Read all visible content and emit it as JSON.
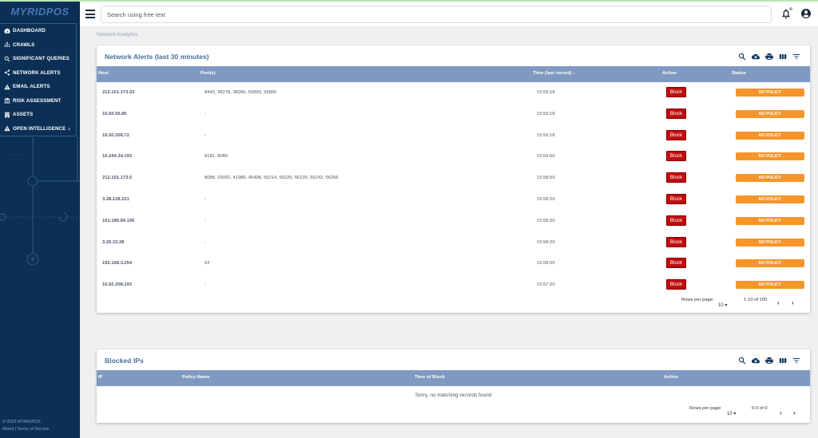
{
  "sidebar": {
    "brand": "MYRIDPOS",
    "items": [
      {
        "label": "DASHBOARD",
        "icon": "dashboard-icon"
      },
      {
        "label": "CRAWLS",
        "icon": "sitemap-icon"
      },
      {
        "label": "SIGNIFICANT QUERIES",
        "icon": "search-icon"
      },
      {
        "label": "NETWORK ALERTS",
        "icon": "share-icon"
      },
      {
        "label": "EMAIL ALERTS",
        "icon": "warning-icon"
      },
      {
        "label": "RISK ASSESSMENT",
        "icon": "bank-icon"
      },
      {
        "label": "ASSETS",
        "icon": "building-icon"
      },
      {
        "label": "OPEN INTELLIGENCE",
        "icon": "warning-icon"
      }
    ],
    "footer_copyright": "© 2023 MYRIDPOS",
    "footer_about": "About",
    "footer_sep": " | ",
    "footer_terms": "Terms of Service"
  },
  "topbar": {
    "search_placeholder": "Search using free text"
  },
  "breadcrumb": "Network Analytics",
  "alerts": {
    "title": "Network Alerts (last 30 minutes)",
    "columns": {
      "host": "Host",
      "ports": "Port(s)",
      "time": "Time (last record)",
      "sort_arrow": "↓",
      "action": "Action",
      "status": "Status"
    },
    "rows": [
      {
        "host": "212.101.173.33",
        "ports": "8443, 38278, 38286, 56890, 56896",
        "time": "15:59:18",
        "action": "Block",
        "status": "NO POLICY"
      },
      {
        "host": "16.50.56.80",
        "ports": "-",
        "time": "15:59:18",
        "action": "Block",
        "status": "NO POLICY"
      },
      {
        "host": "16.50.208.72",
        "ports": "-",
        "time": "15:59:18",
        "action": "Block",
        "status": "NO POLICY"
      },
      {
        "host": "10.244.34.193",
        "ports": "8181, 8080",
        "time": "15:59:00",
        "action": "Block",
        "status": "NO POLICY"
      },
      {
        "host": "212.101.173.5",
        "ports": "8088, 29092, 41986, 45498, 56214, 56226, 56230, 56242, 56256",
        "time": "15:58:50",
        "action": "Block",
        "status": "NO POLICY"
      },
      {
        "host": "3.28.138.221",
        "ports": "-",
        "time": "15:58:20",
        "action": "Block",
        "status": "NO POLICY"
      },
      {
        "host": "161.189.84.196",
        "ports": "-",
        "time": "15:58:20",
        "action": "Block",
        "status": "NO POLICY"
      },
      {
        "host": "3.29.33.28",
        "ports": "-",
        "time": "15:58:20",
        "action": "Block",
        "status": "NO POLICY"
      },
      {
        "host": "192.168.3.254",
        "ports": "53",
        "time": "15:58:00",
        "action": "Block",
        "status": "NO POLICY"
      },
      {
        "host": "16.50.208.193",
        "ports": "-",
        "time": "15:57:20",
        "action": "Block",
        "status": "NO POLICY"
      }
    ],
    "pagination": {
      "rows_label": "Rows per page:",
      "rows_value": "10 ▾",
      "range": "1-10 of 100",
      "prev": "‹",
      "next": "›"
    }
  },
  "blocked": {
    "title": "Blocked IPs",
    "columns": {
      "ip": "IP",
      "policy": "Policy Name",
      "time": "Time of Block",
      "action": "Action"
    },
    "empty_text": "Sorry, no matching records found",
    "pagination": {
      "rows_label": "Rows per page:",
      "rows_value": "10 ▾",
      "range": "0-0 of 0",
      "prev": "‹",
      "next": "›"
    }
  },
  "colors": {
    "sidebar": "#0b2f55",
    "header_row": "#8099c1",
    "block": "#c00d0d",
    "status": "#f5952a",
    "title": "#4a6f98"
  }
}
